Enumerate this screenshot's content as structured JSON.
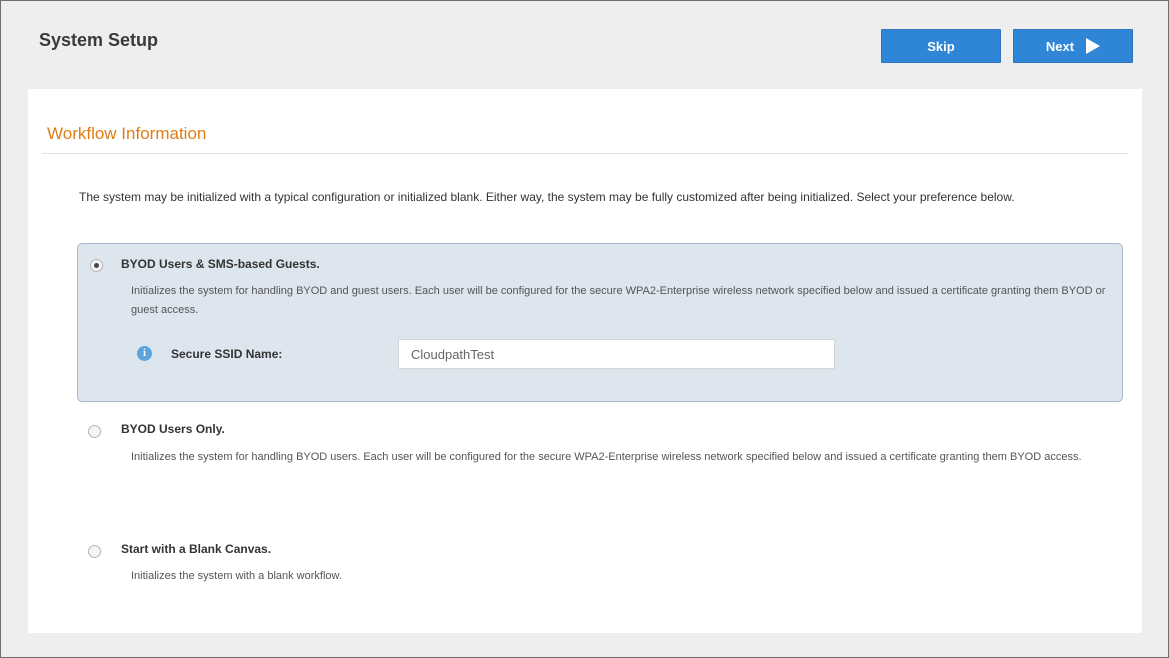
{
  "header": {
    "title": "System Setup",
    "skip_label": "Skip",
    "next_label": "Next"
  },
  "section": {
    "title": "Workflow Information",
    "intro": "The system may be initialized with a typical configuration or initialized blank. Either way, the system may be fully customized after being initialized. Select your preference below."
  },
  "options": [
    {
      "title": "BYOD Users & SMS-based Guests.",
      "description": "Initializes the system for handling BYOD and guest users. Each user will be configured for the secure WPA2-Enterprise wireless network specified below and issued a certificate granting them BYOD or guest access.",
      "selected": true
    },
    {
      "title": "BYOD Users Only.",
      "description": "Initializes the system for handling BYOD users. Each user will be configured for the secure WPA2-Enterprise wireless network specified below and issued a certificate granting them BYOD access.",
      "selected": false
    },
    {
      "title": "Start with a Blank Canvas.",
      "description": "Initializes the system with a blank workflow.",
      "selected": false
    }
  ],
  "ssid": {
    "label": "Secure SSID Name:",
    "value": "CloudpathTest"
  },
  "icons": {
    "info": "info-icon",
    "next_arrow": "play-arrow-icon"
  },
  "colors": {
    "accent_orange": "#e07c16",
    "button_blue": "#2f86d6",
    "selected_option_bg": "#dde6ee"
  }
}
